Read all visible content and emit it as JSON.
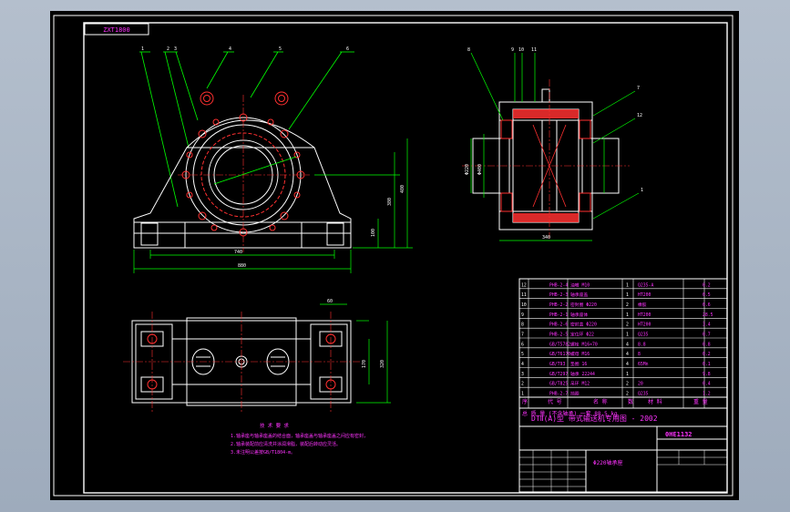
{
  "drawing": {
    "stamp": "ZXT1800",
    "part_number": "0HE1132",
    "system_title": "DTⅡ(A)型  带式输送机专用图 - 2002",
    "drawing_name": "Φ220轴承座"
  },
  "notes": {
    "heading": "技 术 要 求",
    "lines": [
      "1.轴承座与轴承座盖的结合面，轴承座盖与轴承座盖之间应有密封，",
      "2.轴承装配前应清洗并涂润滑脂，装配后转动应灵活。",
      "3.未注明公差按GB/T1804-m。"
    ]
  },
  "bom": {
    "header": [
      "序",
      "代 号",
      "名 称",
      "数",
      "材 料",
      "重 量"
    ],
    "rows": [
      [
        "12",
        "PHB-2-4",
        "油嘴 M10",
        "1",
        "Q235-A",
        "0.2"
      ],
      [
        "11",
        "PHB-2-3",
        "轴承座盖",
        "1",
        "HT200",
        "0.5"
      ],
      [
        "10",
        "PHB-2-2",
        "密封圈 Φ220",
        "2",
        "橡胶",
        "0.6"
      ],
      [
        "9",
        "PHB-2-1",
        "轴承座体",
        "1",
        "HT200",
        "28.5"
      ],
      [
        "8",
        "PHB-2-6",
        "密封盖 Φ220",
        "2",
        "HT200",
        "3.4"
      ],
      [
        "7",
        "PHB-2-5",
        "定位环 Φ22",
        "1",
        "Q235",
        "0.7"
      ],
      [
        "6",
        "GB/T5782",
        "螺栓 M16×70",
        "4",
        "8.8",
        "0.8"
      ],
      [
        "5",
        "GB/T6170",
        "螺母 M16",
        "4",
        "8",
        "0.2"
      ],
      [
        "4",
        "GB/T93",
        "垫圈 16",
        "4",
        "65Mn",
        "0.1"
      ],
      [
        "3",
        "GB/T297",
        "轴承 22244",
        "1",
        "",
        "9.8"
      ],
      [
        "2",
        "GB/T825",
        "吊环 M12",
        "2",
        "20",
        "0.4"
      ],
      [
        "1",
        "PHB-2-7",
        "挡圈",
        "2",
        "Q235",
        "1.2"
      ]
    ],
    "footer": "总 质 量  (不含轴承)  一套   88.5 kg"
  }
}
